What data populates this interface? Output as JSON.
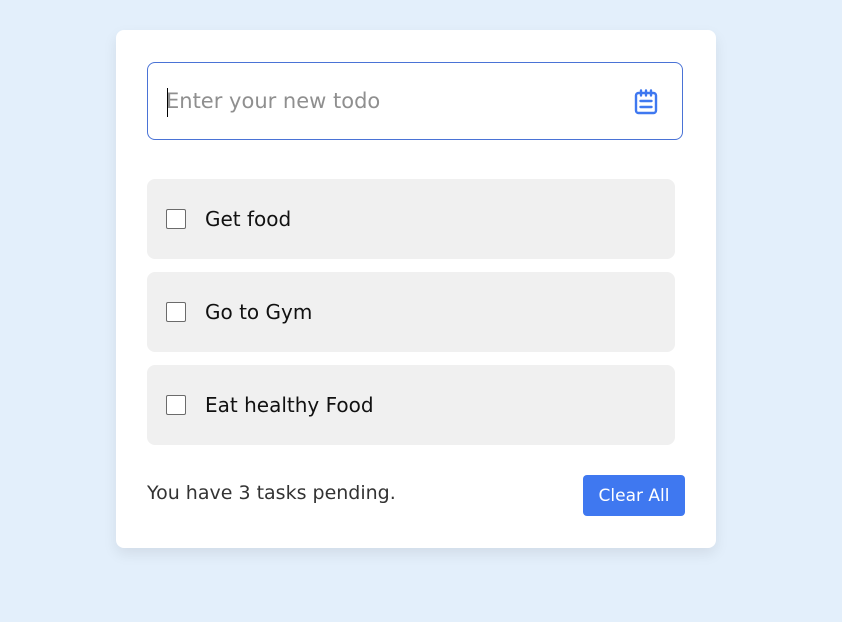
{
  "input": {
    "placeholder": "Enter your new todo",
    "value": "",
    "icon": "notepad-icon",
    "accent_color": "#3f78f0"
  },
  "todos": [
    {
      "label": "Get food",
      "checked": false
    },
    {
      "label": "Go to Gym",
      "checked": false
    },
    {
      "label": "Eat healthy Food",
      "checked": false
    }
  ],
  "footer": {
    "pending_text": "You have 3 tasks pending.",
    "clear_button_label": "Clear All"
  },
  "colors": {
    "background": "#e3effb",
    "card": "#ffffff",
    "item_background": "#f0f0f0",
    "button": "#3f78f0"
  }
}
